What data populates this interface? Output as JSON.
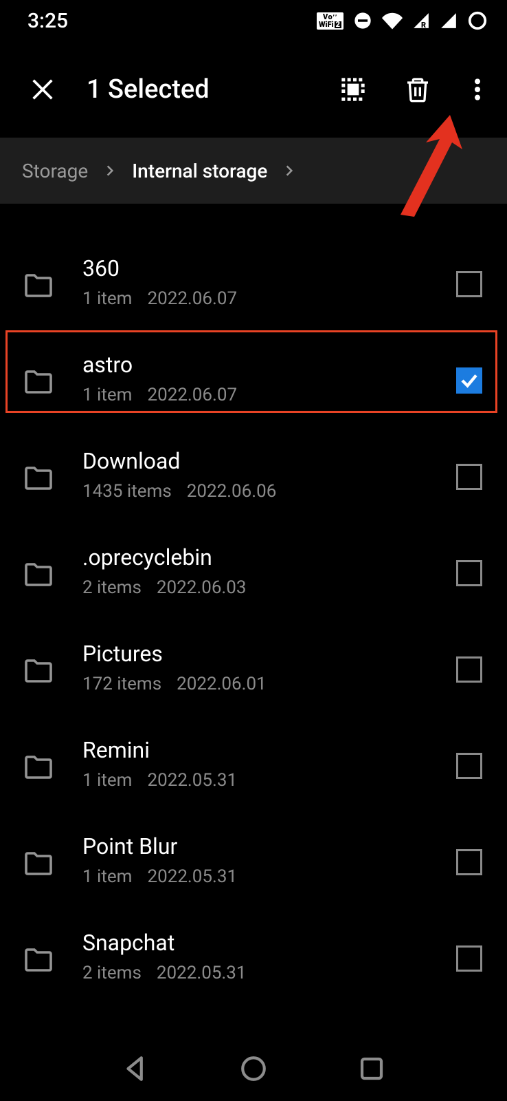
{
  "status": {
    "time": "3:25"
  },
  "header": {
    "title": "1 Selected"
  },
  "breadcrumb": {
    "root": "Storage",
    "current": "Internal storage"
  },
  "folders": [
    {
      "name": "360",
      "items": "1 item",
      "date": "2022.06.07",
      "checked": false
    },
    {
      "name": "astro",
      "items": "1 item",
      "date": "2022.06.07",
      "checked": true
    },
    {
      "name": "Download",
      "items": "1435 items",
      "date": "2022.06.06",
      "checked": false
    },
    {
      "name": ".oprecyclebin",
      "items": "2 items",
      "date": "2022.06.03",
      "checked": false
    },
    {
      "name": "Pictures",
      "items": "172 items",
      "date": "2022.06.01",
      "checked": false
    },
    {
      "name": "Remini",
      "items": "1 item",
      "date": "2022.05.31",
      "checked": false
    },
    {
      "name": "Point Blur",
      "items": "1 item",
      "date": "2022.05.31",
      "checked": false
    },
    {
      "name": "Snapchat",
      "items": "2 items",
      "date": "2022.05.31",
      "checked": false
    }
  ]
}
